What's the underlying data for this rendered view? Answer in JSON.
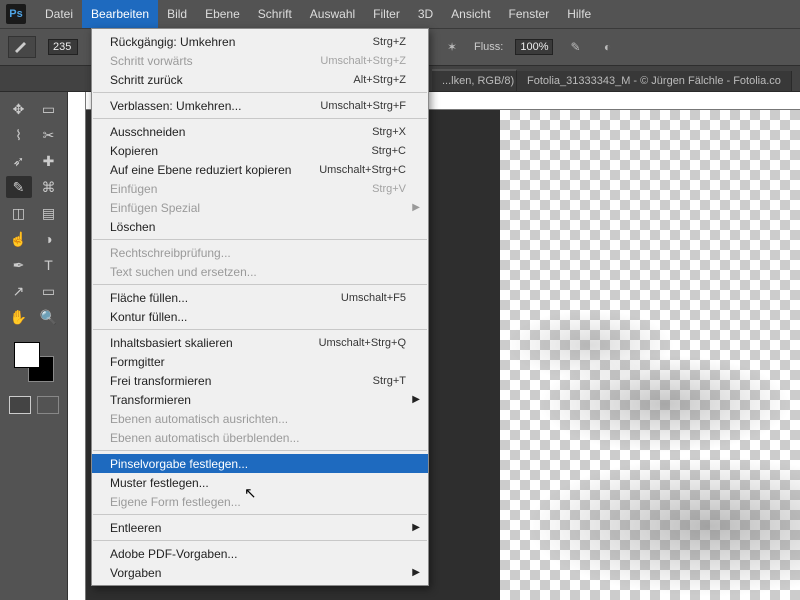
{
  "app": {
    "logo": "Ps"
  },
  "menubar": [
    "Datei",
    "Bearbeiten",
    "Bild",
    "Ebene",
    "Schrift",
    "Auswahl",
    "Filter",
    "3D",
    "Ansicht",
    "Fenster",
    "Hilfe"
  ],
  "menubar_open_index": 1,
  "options": {
    "brush_size": "235",
    "fluss_label": "Fluss:",
    "fluss_value": "100%"
  },
  "tabs": [
    {
      "label": "...lken, RGB/8) *",
      "active": true
    },
    {
      "label": "Fotolia_31333343_M - © Jürgen Fälchle - Fotolia.co",
      "active": false
    }
  ],
  "tools_left": [
    "move",
    "marquee",
    "lasso",
    "crop",
    "eyedrop",
    "heal",
    "brush",
    "stamp",
    "eraser",
    "gradient",
    "smudge",
    "dodge",
    "pen",
    "type",
    "path",
    "shape",
    "hand",
    "zoom"
  ],
  "dropdown": {
    "groups": [
      [
        {
          "label": "Rückgängig: Umkehren",
          "shortcut": "Strg+Z"
        },
        {
          "label": "Schritt vorwärts",
          "shortcut": "Umschalt+Strg+Z",
          "disabled": true
        },
        {
          "label": "Schritt zurück",
          "shortcut": "Alt+Strg+Z"
        }
      ],
      [
        {
          "label": "Verblassen: Umkehren...",
          "shortcut": "Umschalt+Strg+F"
        }
      ],
      [
        {
          "label": "Ausschneiden",
          "shortcut": "Strg+X"
        },
        {
          "label": "Kopieren",
          "shortcut": "Strg+C"
        },
        {
          "label": "Auf eine Ebene reduziert kopieren",
          "shortcut": "Umschalt+Strg+C"
        },
        {
          "label": "Einfügen",
          "shortcut": "Strg+V",
          "disabled": true
        },
        {
          "label": "Einfügen Spezial",
          "submenu": true,
          "disabled": true
        },
        {
          "label": "Löschen"
        }
      ],
      [
        {
          "label": "Rechtschreibprüfung...",
          "disabled": true
        },
        {
          "label": "Text suchen und ersetzen...",
          "disabled": true
        }
      ],
      [
        {
          "label": "Fläche füllen...",
          "shortcut": "Umschalt+F5"
        },
        {
          "label": "Kontur füllen..."
        }
      ],
      [
        {
          "label": "Inhaltsbasiert skalieren",
          "shortcut": "Umschalt+Strg+Q"
        },
        {
          "label": "Formgitter"
        },
        {
          "label": "Frei transformieren",
          "shortcut": "Strg+T"
        },
        {
          "label": "Transformieren",
          "submenu": true
        },
        {
          "label": "Ebenen automatisch ausrichten...",
          "disabled": true
        },
        {
          "label": "Ebenen automatisch überblenden...",
          "disabled": true
        }
      ],
      [
        {
          "label": "Pinselvorgabe festlegen...",
          "hover": true
        },
        {
          "label": "Muster festlegen..."
        },
        {
          "label": "Eigene Form festlegen...",
          "disabled": true
        }
      ],
      [
        {
          "label": "Entleeren",
          "submenu": true
        }
      ],
      [
        {
          "label": "Adobe PDF-Vorgaben..."
        },
        {
          "label": "Vorgaben",
          "submenu": true
        }
      ]
    ]
  }
}
